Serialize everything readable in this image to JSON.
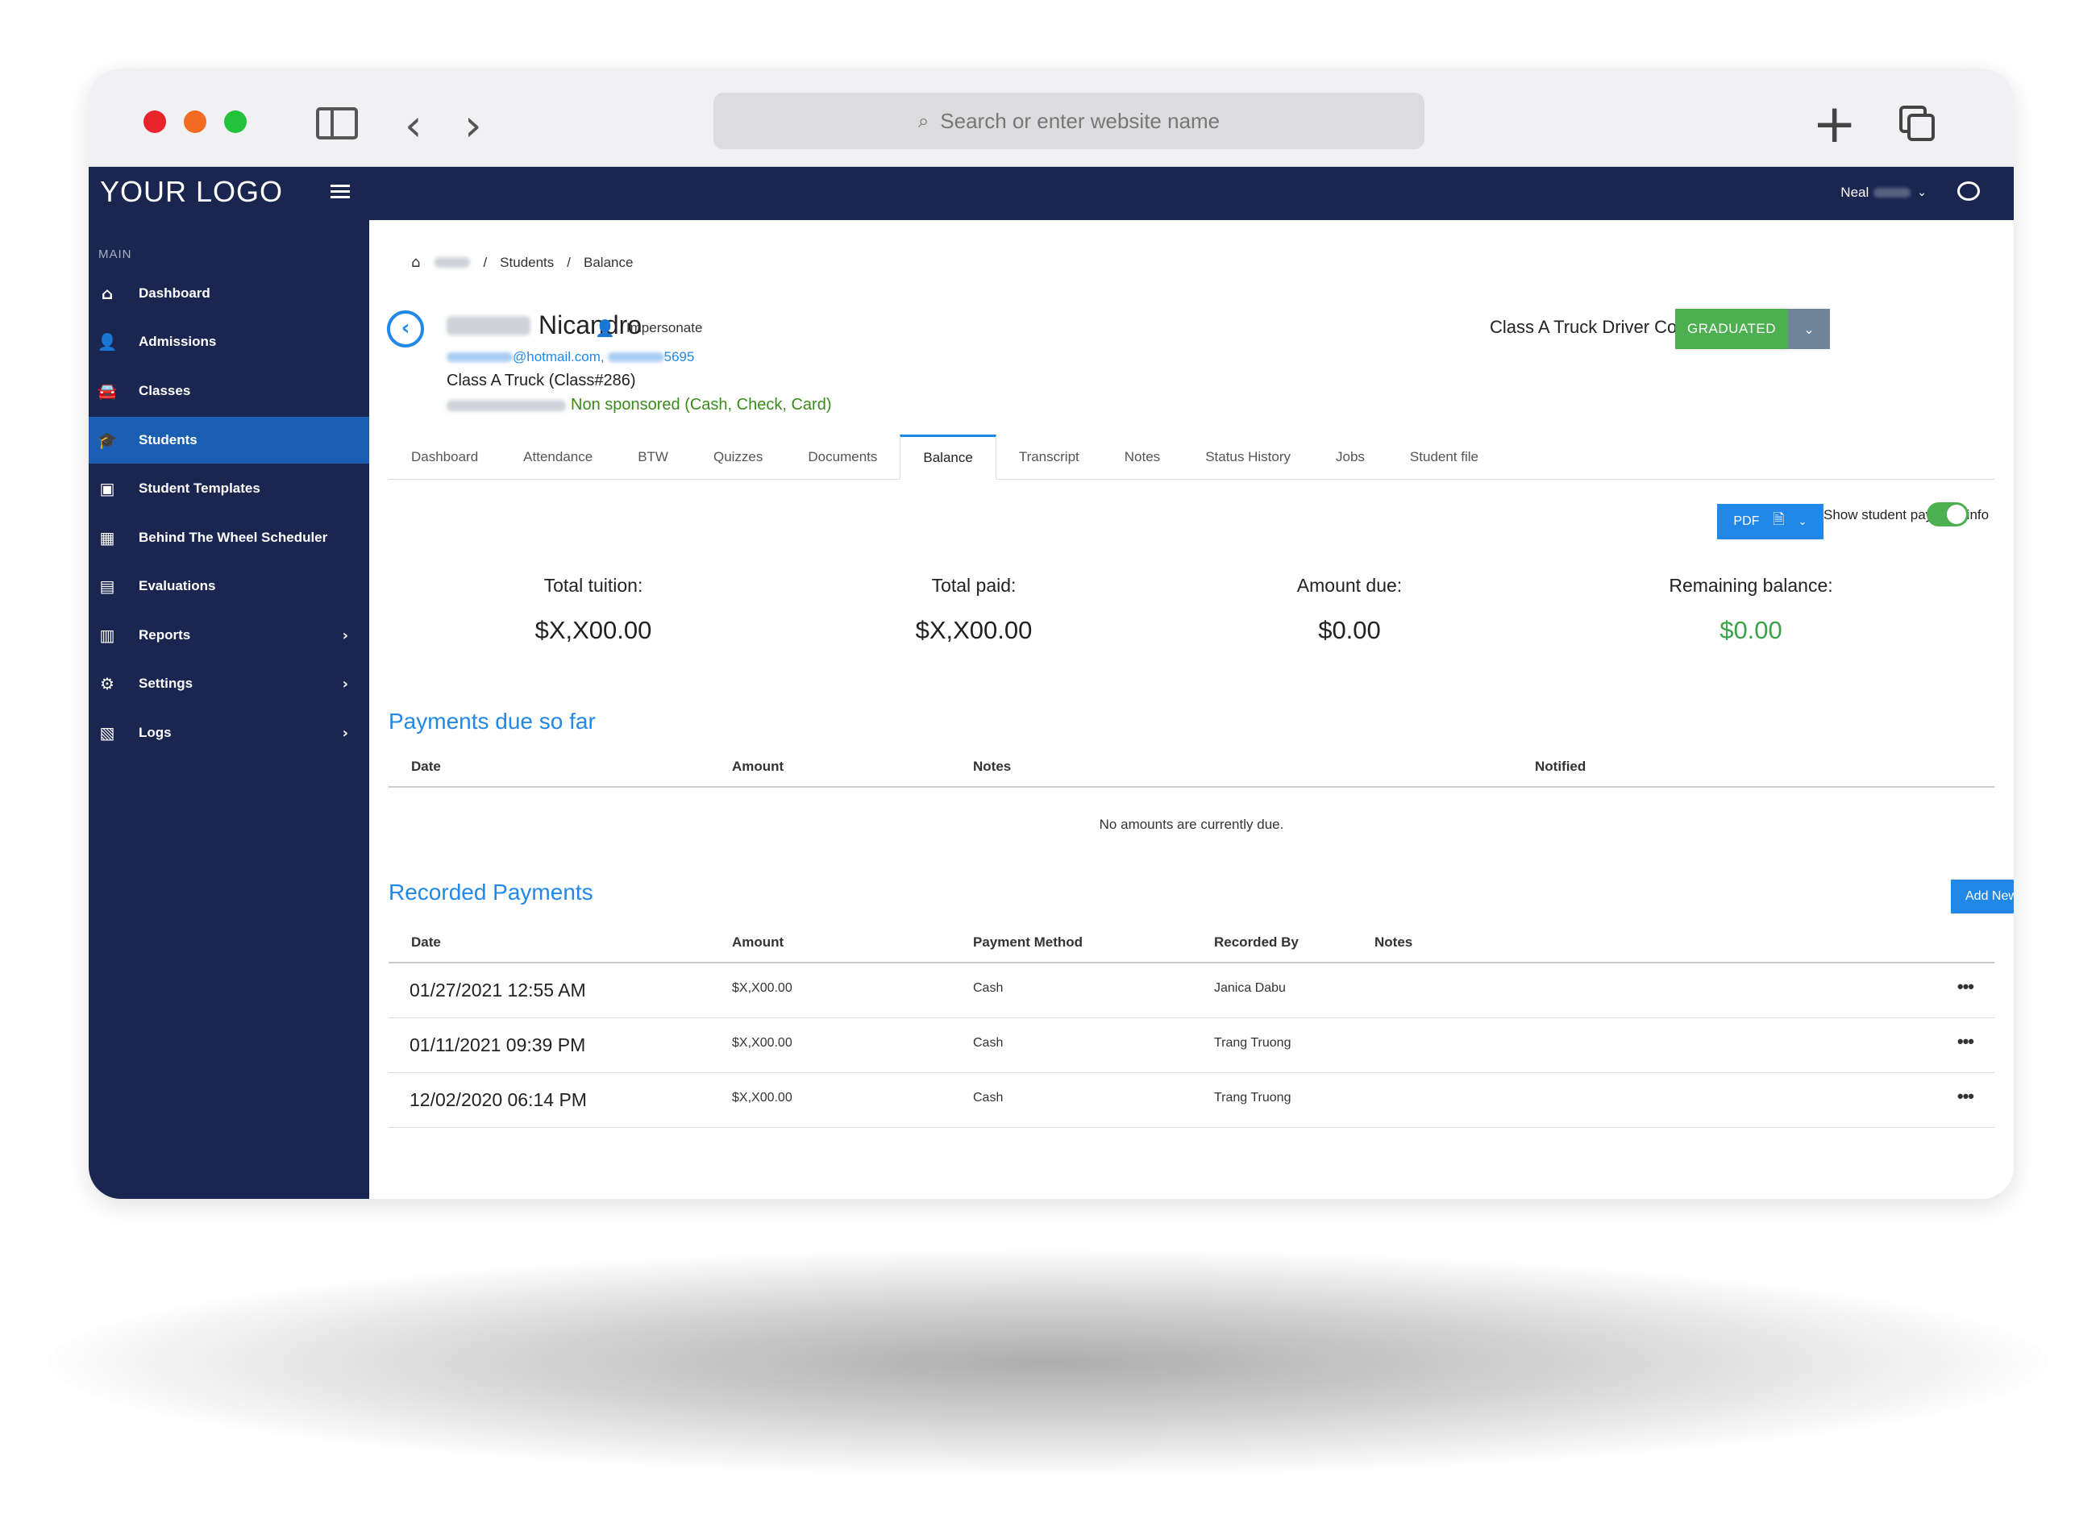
{
  "browser": {
    "url_placeholder": "Search or enter website name"
  },
  "topbar": {
    "logo": "YOUR LOGO",
    "user_first_name": "Neal"
  },
  "sidebar": {
    "section": "MAIN",
    "items": [
      {
        "label": "Dashboard",
        "icon": "home-icon",
        "glyph": "⌂"
      },
      {
        "label": "Admissions",
        "icon": "user-icon",
        "glyph": "👤"
      },
      {
        "label": "Classes",
        "icon": "car-icon",
        "glyph": "🚘"
      },
      {
        "label": "Students",
        "icon": "graduation-cap-icon",
        "glyph": "🎓"
      },
      {
        "label": "Student Templates",
        "icon": "address-book-icon",
        "glyph": "▣"
      },
      {
        "label": "Behind The Wheel Scheduler",
        "icon": "calendar-icon",
        "glyph": "▦"
      },
      {
        "label": "Evaluations",
        "icon": "clipboard-icon",
        "glyph": "▤"
      },
      {
        "label": "Reports",
        "icon": "report-icon",
        "glyph": "▥"
      },
      {
        "label": "Settings",
        "icon": "gear-icon",
        "glyph": "⚙"
      },
      {
        "label": "Logs",
        "icon": "logs-icon",
        "glyph": "▧"
      }
    ],
    "active_index": 3
  },
  "breadcrumb": {
    "items": [
      "Students",
      "Balance"
    ],
    "separator": "/"
  },
  "student": {
    "first_name": "Nicandro",
    "contact_email_suffix": "@hotmail.com,",
    "contact_phone_suffix": "5695",
    "class_line": "Class A Truck (Class#286)",
    "sponsorship": "Non sponsored (Cash, Check, Card)",
    "impersonate_label": "Impersonate",
    "course": "Class A Truck Driver Course",
    "status": "GRADUATED"
  },
  "tabs": [
    {
      "label": "Dashboard"
    },
    {
      "label": "Attendance"
    },
    {
      "label": "BTW"
    },
    {
      "label": "Quizzes"
    },
    {
      "label": "Documents"
    },
    {
      "label": "Balance"
    },
    {
      "label": "Transcript"
    },
    {
      "label": "Notes"
    },
    {
      "label": "Status History"
    },
    {
      "label": "Jobs"
    },
    {
      "label": "Student file"
    }
  ],
  "active_tab": "Balance",
  "actions": {
    "pdf_label": "PDF",
    "show_payment_info_label": "Show student payment info",
    "show_payment_info_on": true
  },
  "summary": {
    "total_tuition_label": "Total tuition:",
    "total_tuition_value": "$X,X00.00",
    "total_paid_label": "Total paid:",
    "total_paid_value": "$X,X00.00",
    "amount_due_label": "Amount due:",
    "amount_due_value": "$0.00",
    "remaining_label": "Remaining balance:",
    "remaining_value": "$0.00"
  },
  "payments_due": {
    "title": "Payments due so far",
    "columns": [
      "Date",
      "Amount",
      "Notes",
      "Notified"
    ],
    "empty_message": "No amounts are currently due."
  },
  "recorded_payments": {
    "title": "Recorded Payments",
    "columns": [
      "Date",
      "Amount",
      "Payment Method",
      "Recorded By",
      "Notes"
    ],
    "add_label": "Add New",
    "rows": [
      {
        "date": "01/27/2021 12:55 AM",
        "amount": "$X,X00.00",
        "method": "Cash",
        "recorded_by": "Janica Dabu",
        "more": "•••"
      },
      {
        "date": "01/11/2021 09:39 PM",
        "amount": "$X,X00.00",
        "method": "Cash",
        "recorded_by": "Trang Truong",
        "more": "•••"
      },
      {
        "date": "12/02/2020 06:14 PM",
        "amount": "$X,X00.00",
        "method": "Cash",
        "recorded_by": "Trang Truong",
        "more": "•••"
      }
    ]
  },
  "colors": {
    "navy": "#1a2550",
    "accent_blue": "#2188e8",
    "active_side": "#1a5fb4",
    "success_green": "#4caf50",
    "sponsor_green": "#3a8a1c"
  }
}
